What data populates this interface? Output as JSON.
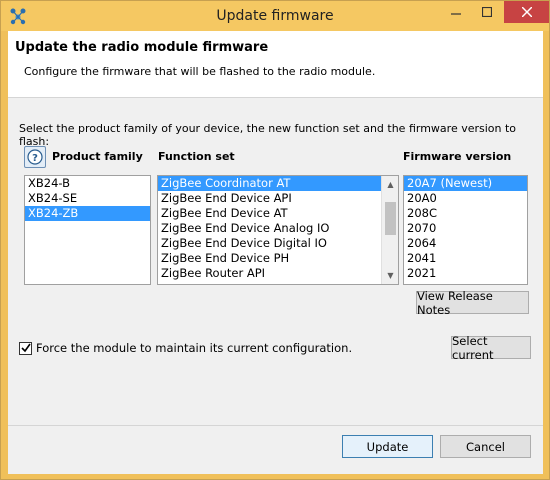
{
  "window": {
    "title": "Update firmware",
    "app_icon": "xctu-network-icon"
  },
  "header": {
    "title": "Update the radio module firmware",
    "description": "Configure the firmware that will be flashed to the radio module."
  },
  "instruction": "Select the product family of your device, the new function set and the firmware version to flash:",
  "columns": {
    "product_family_label": "Product family",
    "function_set_label": "Function set",
    "firmware_version_label": "Firmware version"
  },
  "product_families": [
    {
      "label": "XB24-B",
      "selected": false
    },
    {
      "label": "XB24-SE",
      "selected": false
    },
    {
      "label": "XB24-ZB",
      "selected": true
    }
  ],
  "function_sets": [
    {
      "label": "ZigBee Coordinator AT",
      "selected": true
    },
    {
      "label": "ZigBee End Device API",
      "selected": false
    },
    {
      "label": "ZigBee End Device AT",
      "selected": false
    },
    {
      "label": "ZigBee End Device Analog IO",
      "selected": false
    },
    {
      "label": "ZigBee End Device Digital IO",
      "selected": false
    },
    {
      "label": "ZigBee End Device PH",
      "selected": false
    },
    {
      "label": "ZigBee Router API",
      "selected": false
    }
  ],
  "firmware_versions": [
    {
      "label": "20A7 (Newest)",
      "selected": true
    },
    {
      "label": "20A0",
      "selected": false
    },
    {
      "label": "208C",
      "selected": false
    },
    {
      "label": "2070",
      "selected": false
    },
    {
      "label": "2064",
      "selected": false
    },
    {
      "label": "2041",
      "selected": false
    },
    {
      "label": "2021",
      "selected": false
    }
  ],
  "buttons": {
    "view_release_notes": "View Release Notes",
    "select_current": "Select current",
    "update": "Update",
    "cancel": "Cancel"
  },
  "force_config": {
    "label": "Force the module to maintain its current configuration.",
    "checked": true
  },
  "colors": {
    "titlebar": "#f5c862",
    "selection": "#3399ff",
    "close_button": "#c74343"
  }
}
